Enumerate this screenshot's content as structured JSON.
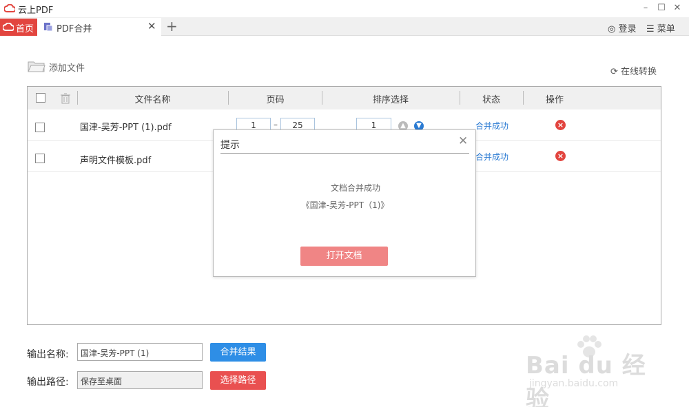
{
  "app": {
    "title": "云上PDF"
  },
  "tabs": {
    "home": "首页",
    "merge": "PDF合并",
    "add": "+"
  },
  "header": {
    "login": "登录",
    "menu": "菜单"
  },
  "toolbar": {
    "add_file": "添加文件",
    "online_convert": "在线转换"
  },
  "table": {
    "headers": {
      "filename": "文件名称",
      "pages": "页码",
      "order": "排序选择",
      "status": "状态",
      "action": "操作"
    },
    "rows": [
      {
        "filename": "国津-吴芳-PPT (1).pdf",
        "page_from": "1",
        "page_sep": "–",
        "page_to": "25",
        "order": "1",
        "status": "合并成功"
      },
      {
        "filename": "声明文件模板.pdf",
        "status": "合并成功"
      }
    ]
  },
  "dialog": {
    "title": "提示",
    "message": "文档合并成功",
    "file": "《国津-吴芳-PPT（1)》",
    "button": "打开文档"
  },
  "output": {
    "name_label": "输出名称:",
    "name_value": "国津-吴芳-PPT (1)",
    "merge_result": "合并结果",
    "path_label": "输出路径:",
    "path_value": "保存至桌面",
    "choose_path": "选择路径"
  },
  "watermark": {
    "brand": "Bai du 经验",
    "url": "jingyan.baidu.com"
  },
  "colors": {
    "home_tab": "#e2453f",
    "status": "#2b7bd3",
    "merge_btn": "#2e8ee6",
    "path_btn": "#e95050",
    "dialog_btn": "#f08585"
  }
}
